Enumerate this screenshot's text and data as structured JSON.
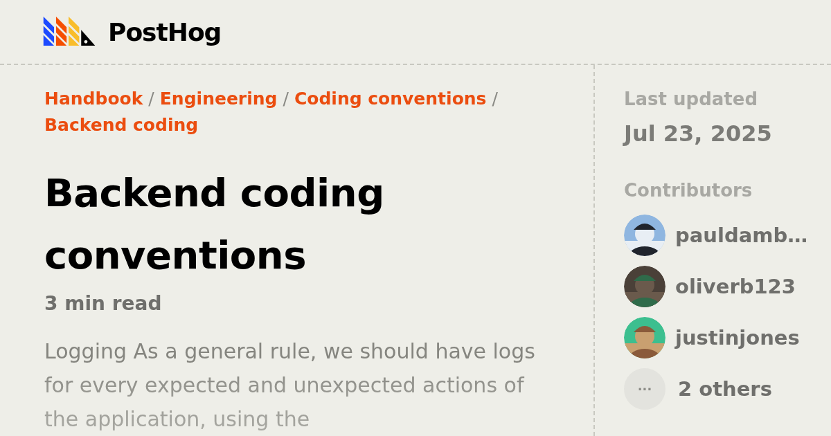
{
  "header": {
    "logo_text": "PostHog"
  },
  "breadcrumb": [
    {
      "label": "Handbook",
      "separator": "/"
    },
    {
      "label": "Engineering",
      "separator": "/"
    },
    {
      "label": "Coding conventions",
      "separator": "/"
    },
    {
      "label": "Backend coding"
    }
  ],
  "title": "Backend coding conventions",
  "read_time": "3 min read",
  "excerpt": "Logging As a general rule, we should have logs for every expected and unexpected actions of the application, using the",
  "sidebar": {
    "updated_label": "Last updated",
    "updated_date": "Jul 23, 2025",
    "contributors_label": "Contributors",
    "contributors": [
      {
        "kind": "person",
        "name": "pauldamb…"
      },
      {
        "kind": "person",
        "name": "oliverb123"
      },
      {
        "kind": "person",
        "name": "justinjones"
      },
      {
        "kind": "more",
        "icon": "···",
        "name": "2 others"
      }
    ]
  }
}
